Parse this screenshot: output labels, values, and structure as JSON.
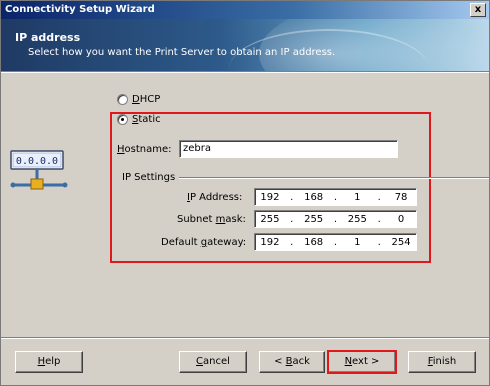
{
  "window": {
    "title": "Connectivity Setup Wizard",
    "close_glyph": "x"
  },
  "header": {
    "title": "IP address",
    "subtitle": "Select how you want the Print Server to obtain an IP address."
  },
  "options": {
    "dhcp": {
      "label_accel": "D",
      "label_rest": "HCP",
      "checked": false
    },
    "static": {
      "label_accel": "S",
      "label_rest": "tatic",
      "checked": true
    }
  },
  "hostname": {
    "label_accel": "H",
    "label_rest": "ostname:",
    "value": "zebra"
  },
  "ip_settings": {
    "group_label": "IP Settings",
    "ip_address": {
      "label_accel": "I",
      "label_rest": "P Address:",
      "octets": [
        "192",
        "168",
        "1",
        "78"
      ]
    },
    "subnet_mask": {
      "label_pre": "Subnet ",
      "label_accel": "m",
      "label_rest": "ask:",
      "octets": [
        "255",
        "255",
        "255",
        "0"
      ]
    },
    "default_gateway": {
      "label_pre": "Default ",
      "label_accel": "g",
      "label_rest": "ateway:",
      "octets": [
        "192",
        "168",
        "1",
        "254"
      ]
    }
  },
  "icon": {
    "name": "network-ip-icon",
    "digits": "0.0.0.0"
  },
  "buttons": {
    "help": {
      "accel": "H",
      "rest": "elp"
    },
    "cancel": {
      "accel": "C",
      "rest": "ancel"
    },
    "back": {
      "pre": "< ",
      "accel": "B",
      "rest": "ack"
    },
    "next": {
      "accel": "N",
      "rest": "ext >"
    },
    "finish": {
      "accel": "F",
      "rest": "inish"
    }
  },
  "colors": {
    "highlight": "#e0171b",
    "title_bar": "#0a246a"
  }
}
